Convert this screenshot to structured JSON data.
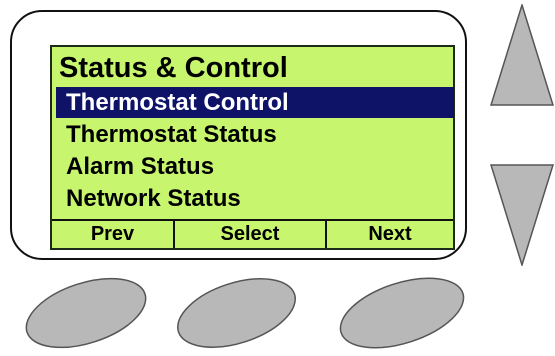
{
  "screen": {
    "title": "Status & Control",
    "menu_items": [
      {
        "label": "Thermostat Control",
        "selected": true
      },
      {
        "label": "Thermostat Status",
        "selected": false
      },
      {
        "label": "Alarm Status",
        "selected": false
      },
      {
        "label": "Network Status",
        "selected": false
      }
    ],
    "softkeys": {
      "prev": "Prev",
      "select": "Select",
      "next": "Next"
    }
  },
  "controls": {
    "up_button_icon": "up-triangle-icon",
    "down_button_icon": "down-triangle-icon",
    "softkey_button_icon": "oval-button-icon"
  },
  "colors": {
    "lcd_background": "#c7f56d",
    "selection_background": "#0e1368",
    "button_fill": "#b8b8b8"
  }
}
